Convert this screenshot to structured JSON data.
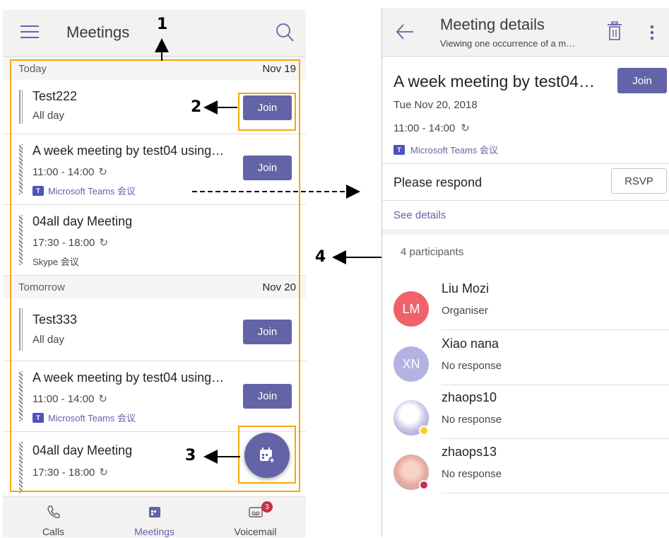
{
  "left_screen": {
    "header": {
      "title": "Meetings"
    },
    "sections": [
      {
        "day": "Today",
        "date": "Nov 19",
        "meetings": [
          {
            "title": "Test222",
            "time": "All day",
            "join": "Join"
          },
          {
            "title": "A week meeting by test04 using…",
            "time": "11:00 - 14:00",
            "location": "Microsoft Teams 会议",
            "join": "Join"
          },
          {
            "title": "04all day Meeting",
            "time": "17:30 - 18:00",
            "location": "Skype 会议"
          }
        ]
      },
      {
        "day": "Tomorrow",
        "date": "Nov 20",
        "meetings": [
          {
            "title": "Test333",
            "time": "All day",
            "join": "Join"
          },
          {
            "title": "A week meeting by test04 using…",
            "time": "11:00 - 14:00",
            "location": "Microsoft Teams 会议",
            "join": "Join"
          },
          {
            "title": "04all day Meeting",
            "time": "17:30 - 18:00"
          }
        ]
      }
    ],
    "tabs": [
      {
        "label": "Calls",
        "icon": "phone-icon"
      },
      {
        "label": "Meetings",
        "icon": "calendar-icon"
      },
      {
        "label": "Voicemail",
        "icon": "voicemail-icon",
        "badge": "3"
      }
    ]
  },
  "right_screen": {
    "header": {
      "title": "Meeting details",
      "subtitle": "Viewing one occurrence of a m…"
    },
    "meeting": {
      "title": "A week meeting by test04…",
      "join": "Join",
      "date": "Tue Nov 20, 2018",
      "time": "11:00 - 14:00",
      "location": "Microsoft Teams 会议"
    },
    "respond_label": "Please respond",
    "rsvp": "RSVP",
    "see_details": "See details",
    "participants_count": "4 participants",
    "participants": [
      {
        "name": "Liu Mozi",
        "status": "Organiser",
        "initials": "LM",
        "color": "#f0626a"
      },
      {
        "name": "Xiao nana",
        "status": "No response",
        "initials": "XN",
        "color": "#b4b2e2"
      },
      {
        "name": "zhaops10",
        "status": "No response",
        "presence_color": "#fcd116"
      },
      {
        "name": "zhaops13",
        "status": "No response",
        "presence_color": "#c4314b"
      }
    ]
  },
  "annotations": {
    "a1": "1",
    "a2": "2",
    "a3": "3",
    "a4": "4"
  },
  "colors": {
    "accent": "#6264a7",
    "highlight": "#f7a70a"
  }
}
